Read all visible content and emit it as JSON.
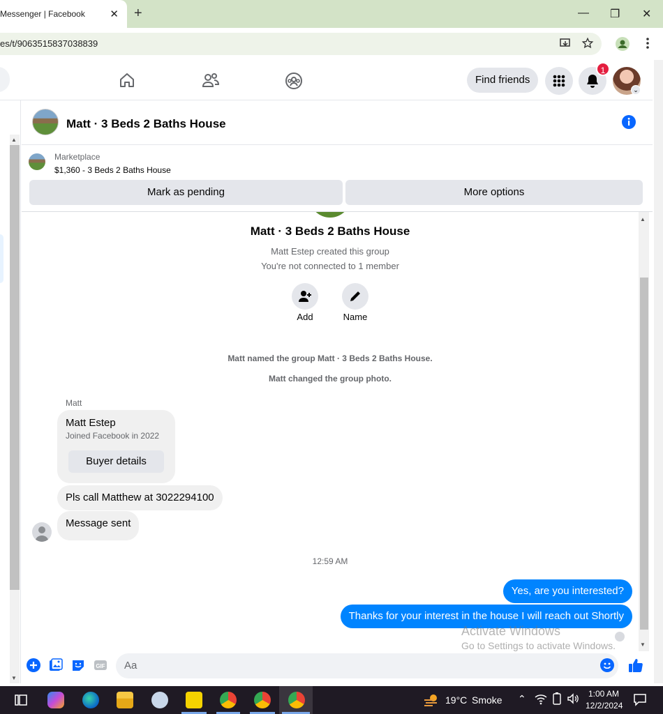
{
  "browser": {
    "tab_title": "Messenger | Facebook",
    "tab_close": "✕",
    "new_tab": "+",
    "url": "es/t/9063515837038839",
    "window_controls": [
      "—",
      "❐",
      "✕"
    ]
  },
  "fb_nav": {
    "find_friends": "Find friends",
    "notification_count": "1",
    "icons": [
      "home-icon",
      "friends-icon",
      "groups-icon",
      "menu-grid-icon",
      "bell-icon"
    ]
  },
  "chat": {
    "title": "Matt · 3 Beds 2 Baths House",
    "marketplace_label": "Marketplace",
    "listing": "$1,360 - 3 Beds 2 Baths House",
    "mark_pending": "Mark as pending",
    "more_options": "More options",
    "group_name": "Matt · 3 Beds 2 Baths House",
    "created_by": "Matt Estep created this group",
    "not_connected": "You're not connected to 1 member",
    "add_label": "Add",
    "name_label": "Name",
    "sys_named": "Matt named the group Matt · 3 Beds 2 Baths House.",
    "sys_photo": "Matt changed the group photo.",
    "sender": "Matt",
    "card_name": "Matt Estep",
    "card_joined": "Joined Facebook in 2022",
    "buyer_details": "Buyer details",
    "msg_call": "Pls call Matthew at 3022294100",
    "msg_sent": "Message sent",
    "timestamp": "12:59 AM",
    "out_1": "Yes, are you interested?",
    "out_2": "Thanks for your interest in the house I will reach out Shortly",
    "input_placeholder": "Aa"
  },
  "watermark": {
    "line1": "Activate Windows",
    "line2": "Go to Settings to activate Windows."
  },
  "taskbar": {
    "temperature": "19°C",
    "weather": "Smoke",
    "time": "1:00 AM",
    "date": "12/2/2024"
  },
  "colors": {
    "accent": "#0084ff",
    "fb_blue": "#0866ff",
    "badge": "#e41e3f",
    "chrome_frame": "#d3e3c7"
  }
}
